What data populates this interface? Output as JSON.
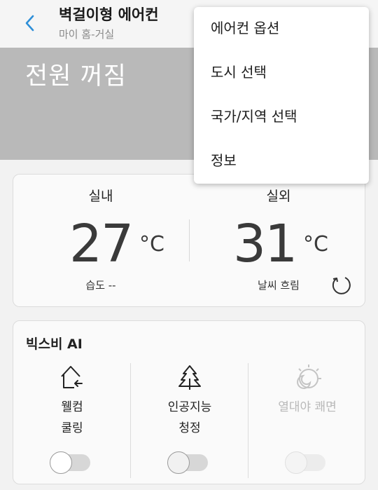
{
  "header": {
    "title": "벽걸이형 에어컨",
    "subtitle": "마이 홈-거실"
  },
  "status": {
    "power_text": "전원 꺼짐"
  },
  "temperature": {
    "indoor": {
      "label": "실내",
      "value": "27",
      "unit": "°C",
      "sub": "습도 --"
    },
    "outdoor": {
      "label": "실외",
      "value": "31",
      "unit": "°C",
      "sub": "날씨 흐림"
    }
  },
  "bixby": {
    "title": "빅스비 AI",
    "items": [
      {
        "label_line1": "웰컴",
        "label_line2": "쿨링",
        "icon": "home-arrow-icon",
        "enabled": true,
        "on": false
      },
      {
        "label_line1": "인공지능",
        "label_line2": "청정",
        "icon": "tree-icon",
        "enabled": true,
        "on": false
      },
      {
        "label_line1": "열대야 쾌면",
        "label_line2": "",
        "icon": "moon-sun-icon",
        "enabled": false,
        "on": false
      }
    ]
  },
  "menu": {
    "items": [
      "에어컨 옵션",
      "도시 선택",
      "국가/지역 선택",
      "정보"
    ]
  },
  "colors": {
    "accent": "#2e8fd8",
    "status_panel": "#b9b9b9",
    "disabled_text": "#b8b8b8"
  }
}
